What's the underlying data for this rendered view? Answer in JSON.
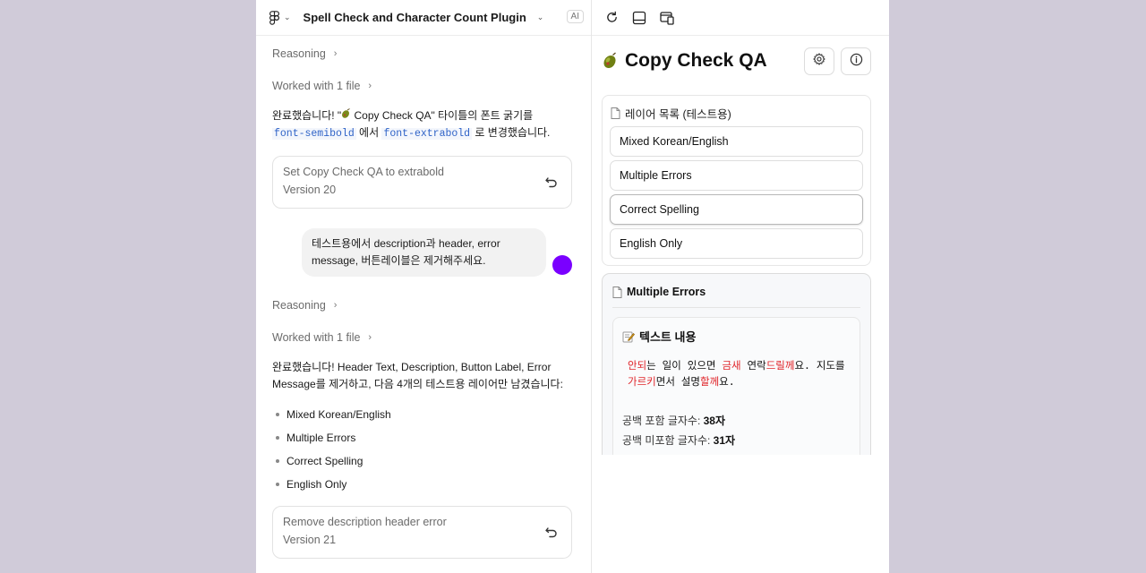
{
  "header": {
    "project_title": "Spell Check and Character Count Plugin",
    "ai_badge": "AI"
  },
  "chat": {
    "reasoning_1": "Reasoning",
    "worked_1": "Worked with 1 file",
    "msg1": {
      "part1": "완료했습니다! \"",
      "part2": " Copy Check QA\" 타이틀의 폰트 굵기를 ",
      "code1": "font-semibold",
      "part3": " 에서 ",
      "code2": "font-extrabold",
      "part4": " 로 변경했습니다."
    },
    "version1": {
      "title": "Set Copy Check QA to extrabold",
      "version": "Version 20"
    },
    "user_message": "테스트용에서 description과 header, error message, 버튼레이블은 제거해주세요.",
    "reasoning_2": "Reasoning",
    "worked_2": "Worked with 1 file",
    "msg2": "완료했습니다! Header Text, Description, Button Label, Error Message를 제거하고, 다음 4개의 테스트용 레이어만 남겼습니다:",
    "bullets": [
      "Mixed Korean/English",
      "Multiple Errors",
      "Correct Spelling",
      "English Only"
    ],
    "version2": {
      "title": "Remove description header error",
      "version": "Version 21"
    }
  },
  "plugin": {
    "title": "Copy Check QA",
    "layers_heading": "레이어 목록 (테스트용)",
    "layers": [
      "Mixed Korean/English",
      "Multiple Errors",
      "Correct Spelling",
      "English Only"
    ],
    "selected_layer": "Correct Spelling",
    "detail_heading": "Multiple Errors",
    "content_heading": "텍스트 내용",
    "content_segments": [
      {
        "t": "안되",
        "err": true
      },
      {
        "t": "는 일이 있으면 ",
        "err": false
      },
      {
        "t": "금새",
        "err": true
      },
      {
        "t": " 연락",
        "err": false
      },
      {
        "t": "드릴께",
        "err": true
      },
      {
        "t": "요. 지도를 ",
        "err": false
      },
      {
        "t": "가르키",
        "err": true
      },
      {
        "t": "면서 설명",
        "err": false
      },
      {
        "t": "할께",
        "err": true
      },
      {
        "t": "요.",
        "err": false
      }
    ],
    "count_with_spaces_label": "공백 포함 글자수: ",
    "count_with_spaces_value": "38자",
    "count_without_spaces_label": "공백 미포함 글자수: ",
    "count_without_spaces_value": "31자"
  },
  "colors": {
    "error": "#e0262b",
    "avatar": "#7a00ff",
    "code": "#2f63c7"
  },
  "icons": {
    "logo": "figma-logo-icon",
    "refresh": "refresh-icon",
    "panel": "panel-icon",
    "window": "window-icon",
    "settings": "gear-icon",
    "info": "info-icon",
    "undo": "undo-icon"
  }
}
